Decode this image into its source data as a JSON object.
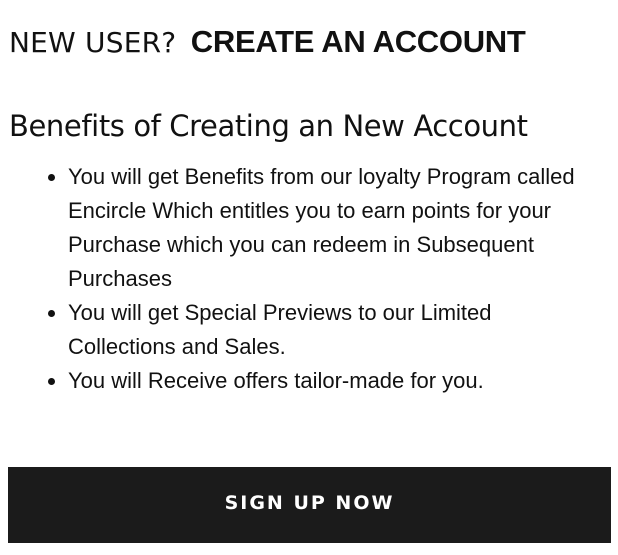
{
  "header": {
    "prefix": "NEW USER?",
    "title": "CREATE AN ACCOUNT"
  },
  "benefits": {
    "title": "Benefits of Creating an New Account",
    "items": [
      "You will get Benefits from our loyalty Program called Encircle Which entitles you to earn points for your Purchase which you can redeem in Subsequent Purchases",
      "You will get Special Previews to our Limited Collections and Sales.",
      "You will Receive offers tailor-made for you."
    ]
  },
  "signup": {
    "label": "SIGN UP NOW"
  },
  "colors": {
    "button_background": "#1b1b1b",
    "button_text": "#ffffff",
    "text": "#111111",
    "background": "#ffffff"
  }
}
